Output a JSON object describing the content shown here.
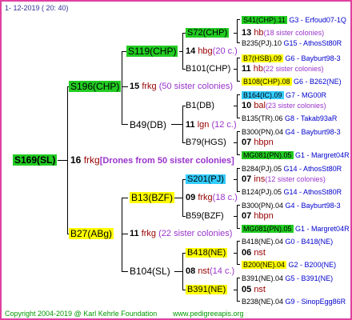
{
  "header": {
    "date": "1- 12-2019 ( 20: 40)"
  },
  "footer": {
    "copyright": "Copyright 2004-2019 @ Karl Kehrle Foundation",
    "site": "www.pedigreeapis.org"
  },
  "colors": {
    "border": "#e040a0",
    "green": "#22cc22",
    "yellow": "#ffff00",
    "blue": "#33ccff",
    "link": "#0000cc",
    "note": "#9933cc",
    "frkg": "#990000"
  },
  "root": {
    "id": "S169(SL)",
    "num": "16",
    "race": "frkg",
    "drones": "[Drones from 50 sister colonies]"
  },
  "gen1": [
    {
      "id": "S196(CHP)",
      "num": "15",
      "race": "frkg",
      "note": "(50 sister colonies)"
    },
    {
      "id": "B27(ABg)",
      "num": "11",
      "race": "frkg",
      "note": "(22 sister colonies)"
    }
  ],
  "gen2": [
    {
      "id": "S119(CHP)",
      "num": "14",
      "race": "hbg",
      "note": "(20 c.)"
    },
    {
      "id": "B49(DB)",
      "num": "11",
      "race": "lgn",
      "note": "(12 c.)"
    },
    {
      "id": "B13(BZF)",
      "num": "09",
      "race": "frkg",
      "note": "(18 c.)"
    },
    {
      "id": "B104(SL)",
      "num": "08",
      "race": "nst",
      "note": "(14 c.)"
    }
  ],
  "gen3": [
    {
      "id": "S72(CHP)",
      "num": "13",
      "race": "hb",
      "note": "(18 sister colonies)"
    },
    {
      "id": "B101(CHP)",
      "num": "11",
      "race": "hb",
      "note": "(22 sister colonies)"
    },
    {
      "id": "B1(DB)",
      "num": "10",
      "race": "bal",
      "note": "(23 sister colonies)"
    },
    {
      "id": "B79(HGS)",
      "num": "07",
      "race": "hbpn",
      "note": ""
    },
    {
      "id": "S201(PJ)",
      "num": "07",
      "race": "ins",
      "note": "(12 sister colonies)"
    },
    {
      "id": "B59(BZF)",
      "num": "07",
      "race": "hbpn",
      "note": ""
    },
    {
      "id": "B418(NE)",
      "num": "06",
      "race": "nst",
      "note": ""
    },
    {
      "id": "B391(NE)",
      "num": "05",
      "race": "nst",
      "note": ""
    }
  ],
  "gen4": [
    {
      "id": "S41(CHP).11",
      "ref": "G3 - Erfoud07-1Q"
    },
    {
      "id": "B235(PJ).10",
      "ref": "G15 - AthosSt80R"
    },
    {
      "id": "B7(HSB).09",
      "ref": "G6 - Bayburt98-3"
    },
    {
      "id": "B108(CHP).08",
      "ref": "G6 - B262(NE)"
    },
    {
      "id": "B164(IC).09",
      "ref": "G7 - MG00R"
    },
    {
      "id": "B135(TR).06",
      "ref": "G8 - Takab93aR"
    },
    {
      "id": "B300(PN).04",
      "ref": "G4 - Bayburt98-3"
    },
    {
      "id": "MG081(PN).05",
      "ref": "G1 - Margret04R"
    },
    {
      "id": "B284(PJ).05",
      "ref": "G14 - AthosSt80R"
    },
    {
      "id": "B124(PJ).05",
      "ref": "G14 - AthosSt80R"
    },
    {
      "id": "B300(PN).04",
      "ref": "G4 - Bayburt98-3"
    },
    {
      "id": "MG081(PN).05",
      "ref": "G1 - Margret04R"
    },
    {
      "id": "B418(NE).04",
      "ref": "G0 - B418(NE)"
    },
    {
      "id": "B200(NE).04",
      "ref": "G2 - B200(NE)"
    },
    {
      "id": "B391(NE).04",
      "ref": "G5 - B391(NE)"
    },
    {
      "id": "B238(NE).04",
      "ref": "G9 - SinopEgg86R"
    }
  ]
}
